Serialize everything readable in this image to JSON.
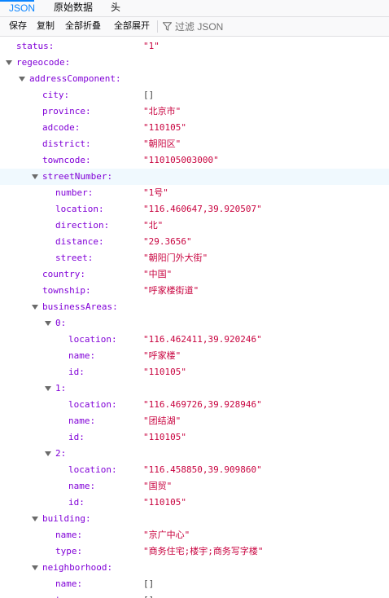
{
  "tabs": [
    {
      "label": "JSON",
      "selected": true
    },
    {
      "label": "原始数据",
      "selected": false
    },
    {
      "label": "头",
      "selected": false
    }
  ],
  "toolbar": {
    "save_label": "保存",
    "copy_label": "复制",
    "collapse_label": "全部折叠",
    "expand_label": "全部展开",
    "filter_placeholder": "过滤 JSON",
    "filter_icon": "filter-icon"
  },
  "colors": {
    "accent": "#0a84ff",
    "key": "#8000d7",
    "string_value": "#c8033f",
    "highlight_row": "#f0f9fe"
  },
  "rows": [
    {
      "key": "status:",
      "value": "\"1\"",
      "type": "str",
      "depth": 0,
      "expandable": false
    },
    {
      "key": "regeocode:",
      "value": "",
      "type": "none",
      "depth": 0,
      "expandable": true
    },
    {
      "key": "addressComponent:",
      "value": "",
      "type": "none",
      "depth": 1,
      "expandable": true
    },
    {
      "key": "city:",
      "value": "[]",
      "type": "arr",
      "depth": 2,
      "expandable": false
    },
    {
      "key": "province:",
      "value": "\"北京市\"",
      "type": "str",
      "depth": 2,
      "expandable": false
    },
    {
      "key": "adcode:",
      "value": "\"110105\"",
      "type": "str",
      "depth": 2,
      "expandable": false
    },
    {
      "key": "district:",
      "value": "\"朝阳区\"",
      "type": "str",
      "depth": 2,
      "expandable": false
    },
    {
      "key": "towncode:",
      "value": "\"110105003000\"",
      "type": "str",
      "depth": 2,
      "expandable": false
    },
    {
      "key": "streetNumber:",
      "value": "",
      "type": "none",
      "depth": 2,
      "expandable": true,
      "highlight": true
    },
    {
      "key": "number:",
      "value": "\"1号\"",
      "type": "str",
      "depth": 3,
      "expandable": false
    },
    {
      "key": "location:",
      "value": "\"116.460647,39.920507\"",
      "type": "str",
      "depth": 3,
      "expandable": false
    },
    {
      "key": "direction:",
      "value": "\"北\"",
      "type": "str",
      "depth": 3,
      "expandable": false
    },
    {
      "key": "distance:",
      "value": "\"29.3656\"",
      "type": "str",
      "depth": 3,
      "expandable": false
    },
    {
      "key": "street:",
      "value": "\"朝阳门外大街\"",
      "type": "str",
      "depth": 3,
      "expandable": false
    },
    {
      "key": "country:",
      "value": "\"中国\"",
      "type": "str",
      "depth": 2,
      "expandable": false
    },
    {
      "key": "township:",
      "value": "\"呼家楼街道\"",
      "type": "str",
      "depth": 2,
      "expandable": false
    },
    {
      "key": "businessAreas:",
      "value": "",
      "type": "none",
      "depth": 2,
      "expandable": true
    },
    {
      "key": "0:",
      "value": "",
      "type": "none",
      "depth": 3,
      "expandable": true
    },
    {
      "key": "location:",
      "value": "\"116.462411,39.920246\"",
      "type": "str",
      "depth": 4,
      "expandable": false
    },
    {
      "key": "name:",
      "value": "\"呼家楼\"",
      "type": "str",
      "depth": 4,
      "expandable": false
    },
    {
      "key": "id:",
      "value": "\"110105\"",
      "type": "str",
      "depth": 4,
      "expandable": false
    },
    {
      "key": "1:",
      "value": "",
      "type": "none",
      "depth": 3,
      "expandable": true
    },
    {
      "key": "location:",
      "value": "\"116.469726,39.928946\"",
      "type": "str",
      "depth": 4,
      "expandable": false
    },
    {
      "key": "name:",
      "value": "\"团结湖\"",
      "type": "str",
      "depth": 4,
      "expandable": false
    },
    {
      "key": "id:",
      "value": "\"110105\"",
      "type": "str",
      "depth": 4,
      "expandable": false
    },
    {
      "key": "2:",
      "value": "",
      "type": "none",
      "depth": 3,
      "expandable": true
    },
    {
      "key": "location:",
      "value": "\"116.458850,39.909860\"",
      "type": "str",
      "depth": 4,
      "expandable": false
    },
    {
      "key": "name:",
      "value": "\"国贸\"",
      "type": "str",
      "depth": 4,
      "expandable": false
    },
    {
      "key": "id:",
      "value": "\"110105\"",
      "type": "str",
      "depth": 4,
      "expandable": false
    },
    {
      "key": "building:",
      "value": "",
      "type": "none",
      "depth": 2,
      "expandable": true
    },
    {
      "key": "name:",
      "value": "\"京广中心\"",
      "type": "str",
      "depth": 3,
      "expandable": false
    },
    {
      "key": "type:",
      "value": "\"商务住宅;楼宇;商务写字楼\"",
      "type": "str",
      "depth": 3,
      "expandable": false
    },
    {
      "key": "neighborhood:",
      "value": "",
      "type": "none",
      "depth": 2,
      "expandable": true
    },
    {
      "key": "name:",
      "value": "[]",
      "type": "arr",
      "depth": 3,
      "expandable": false
    },
    {
      "key": "type:",
      "value": "[]",
      "type": "arr",
      "depth": 3,
      "expandable": false
    }
  ]
}
